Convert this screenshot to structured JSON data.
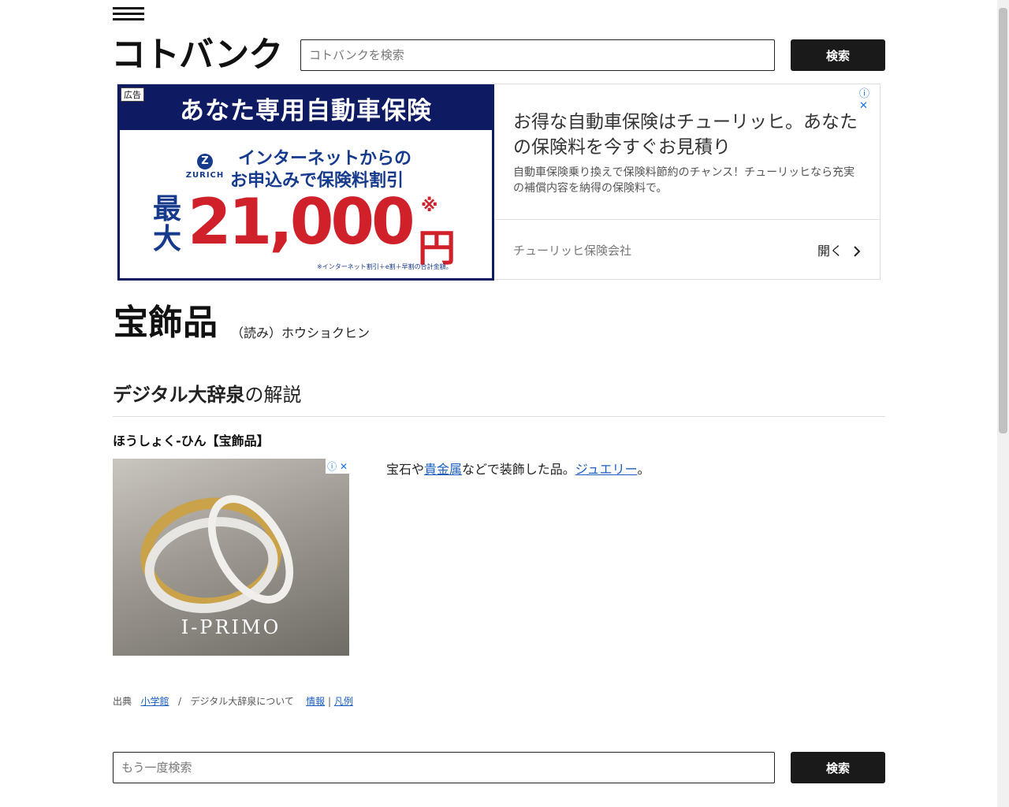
{
  "header": {
    "logo": "コトバンク",
    "search_placeholder": "コトバンクを検索",
    "search_button": "検索"
  },
  "ad_banner": {
    "tag": "広告",
    "headline": "あなた専用自動車保険",
    "brand": "ZURICH",
    "sub1": "インターネットからの",
    "sub2": "お申込みで保険料割引",
    "max_label": "最大",
    "amount": "21,000",
    "mark": "※",
    "yen": "円",
    "note": "※インターネット割引＋e割＋早割の合計金額。",
    "title": "お得な自動車保険はチューリッヒ。あなたの保険料を今すぐお見積り",
    "description": "自動車保険乗り換えで保険料節約のチャンス！チューリッヒなら充実の補償内容を納得の保険料で。",
    "advertiser": "チューリッヒ保険会社",
    "open": "開く",
    "open_icon": "chevron-right-icon",
    "info_icon": "ⓘ",
    "close_icon": "✕"
  },
  "entry": {
    "headword": "宝飾品",
    "reading": "（読み）ホウショクヒン",
    "section_title_bold": "デジタル大辞泉",
    "section_title_rest": "の解説",
    "entry_head": "ほうしょく‐ひん【宝飾品】",
    "definition_1": "宝石や",
    "link_1": "貴金属",
    "definition_2": "などで装飾した品。",
    "link_2": "ジュエリー",
    "definition_3": "。"
  },
  "ring_ad": {
    "brand": "I-PRIMO",
    "info_icon": "ⓘ",
    "close_icon": "✕"
  },
  "source": {
    "label": "出典",
    "publisher": "小学館",
    "sep": "/",
    "about": "デジタル大辞泉について",
    "info": "情報",
    "pipe": "|",
    "legend": "凡例"
  },
  "footer_search": {
    "placeholder": "もう一度検索",
    "button": "検索"
  }
}
